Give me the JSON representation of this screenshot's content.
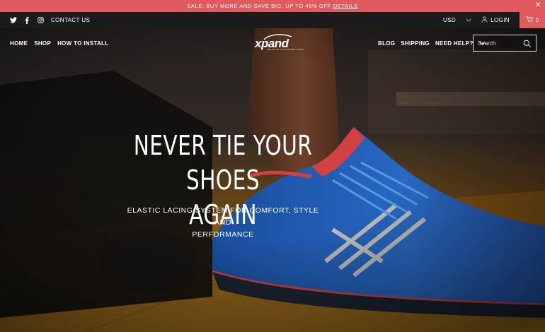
{
  "announcement": {
    "text": "SALE: BUY MORE AND SAVE BIG. UP TO 45% OFF",
    "link": "DETAILS",
    "close_icon": "close-icon"
  },
  "topbar": {
    "social_icons": [
      "twitter-icon",
      "facebook-icon",
      "instagram-icon"
    ],
    "contact_label": "CONTACT US",
    "currency": "USD",
    "login_label": "LOGIN",
    "cart_count": "0"
  },
  "nav": {
    "left": [
      "HOME",
      "SHOP",
      "HOW TO INSTALL"
    ],
    "right": [
      "BLOG",
      "SHIPPING",
      "NEED HELP?"
    ]
  },
  "logo": {
    "word": "xpand",
    "tagline": "NEVER TIE YOUR SHOES AGAIN"
  },
  "search": {
    "placeholder": "Search"
  },
  "hero": {
    "headline_line1": "NEVER TIE YOUR SHOES",
    "headline_line2": "AGAIN",
    "subline_line1": "ELASTIC LACING SYSTEM FOR COMFORT, STYLE AND",
    "subline_line2": "PERFORMANCE"
  },
  "colors": {
    "accent": "#e05a5e",
    "topbar": "#1b1b1b",
    "shoe_blue": "#2b6fd6",
    "shoe_red": "#ef4a4a",
    "floor": "#8a5a16"
  }
}
